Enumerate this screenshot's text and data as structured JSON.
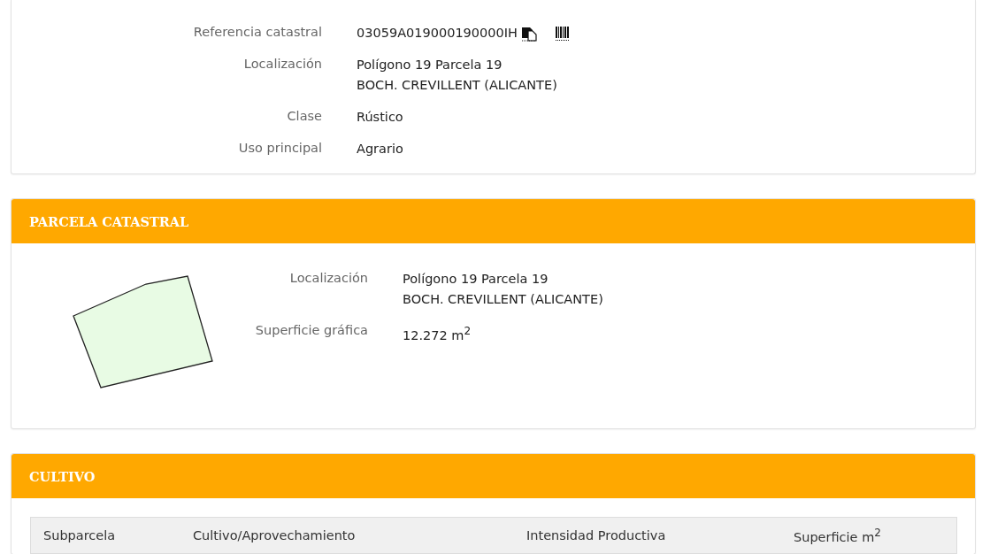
{
  "inmueble": {
    "rows": [
      {
        "label": "Referencia catastral",
        "lines": [
          "03059A019000190000IH"
        ],
        "kind": "reference"
      },
      {
        "label": "Localización",
        "lines": [
          "Polígono 19 Parcela 19",
          "BOCH. CREVILLENT (ALICANTE)"
        ],
        "kind": "text"
      },
      {
        "label": "Clase",
        "lines": [
          "Rústico"
        ],
        "kind": "text"
      },
      {
        "label": "Uso principal",
        "lines": [
          "Agrario"
        ],
        "kind": "text"
      }
    ]
  },
  "parcela": {
    "title": "PARCELA CATASTRAL",
    "picture": {
      "kind": "parcel-map"
    },
    "rows": [
      {
        "label": "Localización",
        "lines": [
          "Polígono 19 Parcela 19",
          "BOCH. CREVILLENT (ALICANTE)"
        ]
      },
      {
        "label": "Superficie gráfica",
        "lines": [
          "12.272 m$^{2}$"
        ]
      }
    ]
  },
  "cultivo": {
    "title": "CULTIVO",
    "table": {
      "columns": [
        "Subparcela",
        "Cultivo/Aprovechamiento",
        "Intensidad Productiva",
        "Superficie m$^{2}$"
      ]
    }
  }
}
